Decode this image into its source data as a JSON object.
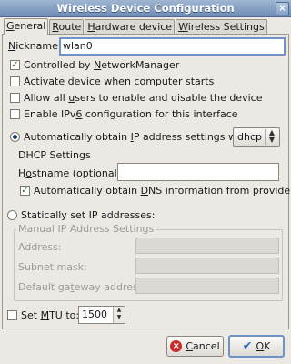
{
  "window": {
    "title": "Wireless Device Configuration",
    "close_glyph": "×"
  },
  "tabs": [
    {
      "label_u": "G",
      "label_rest": "eneral"
    },
    {
      "label_u": "R",
      "label_rest": "oute"
    },
    {
      "label_u": "H",
      "label_rest": "ardware device"
    },
    {
      "label_u": "W",
      "label_rest": "ireless Settings"
    }
  ],
  "nickname": {
    "label_u": "N",
    "label_rest": "ickname:",
    "value": "wlan0"
  },
  "options": {
    "controlled": {
      "pre": "Controlled by ",
      "u": "N",
      "post": "etworkManager",
      "checked": true
    },
    "activate": {
      "pre": "",
      "u": "A",
      "post": "ctivate device when computer starts",
      "checked": false
    },
    "allow_users": {
      "pre": "Allow all ",
      "u": "u",
      "post": "sers to enable and disable the device",
      "checked": false
    },
    "ipv6": {
      "pre": "Enable IPv",
      "u": "6",
      "post": " configuration for this interface",
      "checked": false
    }
  },
  "auto_ip": {
    "pre": "Automatically obtain ",
    "u": "I",
    "post": "P address settings with:",
    "selected": true,
    "method": "dhcp"
  },
  "dhcp": {
    "legend": "DHCP Settings",
    "hostname_pre": "H",
    "hostname_u": "o",
    "hostname_post": "stname (optional):",
    "hostname_value": "",
    "dns_pre": "Automatically obtain ",
    "dns_u": "D",
    "dns_post": "NS information from provider",
    "dns_checked": true
  },
  "static_ip": {
    "label": "Statically set IP addresses:",
    "selected": false
  },
  "manual": {
    "legend": "Manual IP Address Settings",
    "address": "Address:",
    "subnet": "Subnet mask:",
    "gateway_pre": "Default ga",
    "gateway_u": "t",
    "gateway_post": "eway address:"
  },
  "mtu": {
    "pre": "Set ",
    "u": "M",
    "post": "TU to:",
    "checked": false,
    "value": "1500"
  },
  "buttons": {
    "cancel_u": "C",
    "cancel_rest": "ancel",
    "ok_u": "O",
    "ok_rest": "K"
  },
  "colors": {
    "titlebar": "#7a95bd",
    "focus": "#6f93c6",
    "window_bg": "#ece9e4"
  }
}
